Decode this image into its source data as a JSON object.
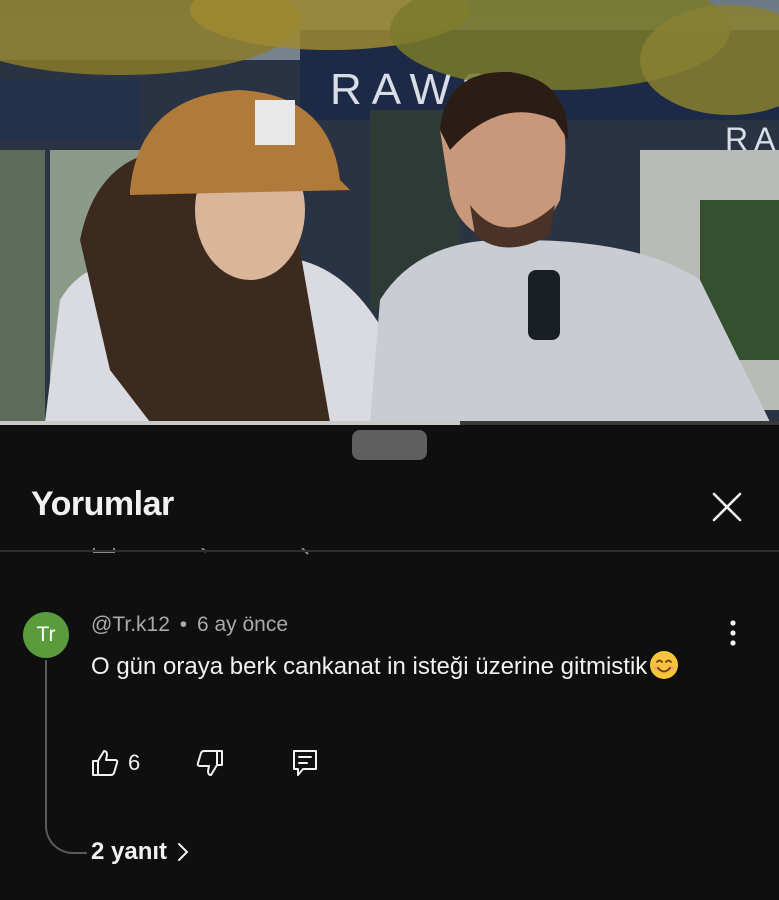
{
  "video": {
    "storefront_text_main": "RAWS",
    "storefront_text_right": "RAW",
    "progress": 0.59
  },
  "sheet": {
    "title": "Yorumlar"
  },
  "comment": {
    "avatar_text": "Tr",
    "author": "@Tr.k12",
    "separator": "•",
    "time": "6 ay önce",
    "text": "O gün oraya berk cankanat in isteği üzerine gitmistik",
    "emoji": "smiling-face-icon",
    "likes": "6",
    "replies_label": "2 yanıt"
  },
  "colors": {
    "background": "#0f0f0f",
    "avatar": "#5a9c3b",
    "meta": "#aaaaaa"
  }
}
